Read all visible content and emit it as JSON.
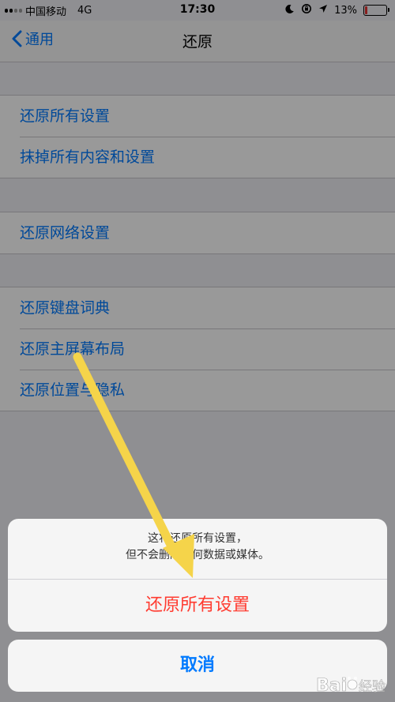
{
  "status_bar": {
    "carrier": "中国移动",
    "network": "4G",
    "time": "17:30",
    "battery": "13%",
    "battery_level": 0.13,
    "battery_color": "#e33333"
  },
  "nav": {
    "back_label": "通用",
    "title": "还原"
  },
  "groups": [
    {
      "items": [
        "还原所有设置",
        "抹掉所有内容和设置"
      ]
    },
    {
      "items": [
        "还原网络设置"
      ]
    },
    {
      "items": [
        "还原键盘词典",
        "还原主屏幕布局",
        "还原位置与隐私"
      ]
    }
  ],
  "action_sheet": {
    "message_line1": "这将还原所有设置，",
    "message_line2": "但不会删除任何数据或媒体。",
    "confirm_label": "还原所有设置",
    "cancel_label": "取消"
  },
  "colors": {
    "accent": "#007aff",
    "destructive": "#ff3b30",
    "annotation_arrow": "#f5d44a"
  },
  "watermark": {
    "text": "Bai经验"
  }
}
